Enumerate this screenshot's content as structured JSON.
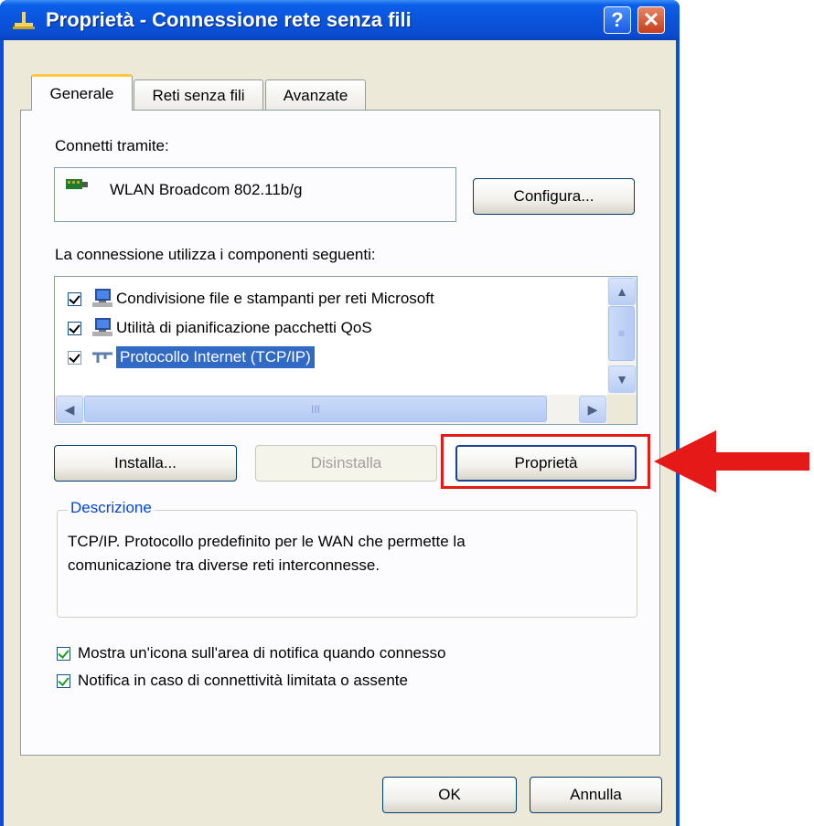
{
  "window": {
    "title": "Proprietà - Connessione rete senza fili",
    "help_glyph": "?",
    "close_glyph": "✕"
  },
  "tabs": [
    {
      "label": "Generale",
      "active": true
    },
    {
      "label": "Reti senza fili",
      "active": false
    },
    {
      "label": "Avanzate",
      "active": false
    }
  ],
  "general": {
    "connect_via_label": "Connetti tramite:",
    "device_name": "WLAN Broadcom 802.11b/g",
    "configure_button": "Configura...",
    "components_label": "La connessione utilizza i componenti seguenti:",
    "components": [
      {
        "label": "Condivisione file e stampanti per reti Microsoft",
        "checked": true,
        "selected": false,
        "icon": "network-computer-icon"
      },
      {
        "label": "Utilità di pianificazione pacchetti QoS",
        "checked": true,
        "selected": false,
        "icon": "network-computer-icon"
      },
      {
        "label": "Protocollo Internet (TCP/IP)",
        "checked": true,
        "selected": true,
        "icon": "protocol-icon"
      }
    ],
    "scroll_thumb_glyph": "III",
    "install_button": "Installa...",
    "uninstall_button": "Disinstalla",
    "properties_button": "Proprietà",
    "description_title": "Descrizione",
    "description_text_line1": "TCP/IP. Protocollo predefinito per le WAN che permette la",
    "description_text_line2": "comunicazione tra diverse reti interconnesse.",
    "show_icon_option": {
      "label": "Mostra un'icona sull'area di notifica quando connesso",
      "checked": true
    },
    "notify_option": {
      "label": "Notifica in caso di connettività limitata o assente",
      "checked": true
    }
  },
  "footer": {
    "ok_button": "OK",
    "cancel_button": "Annulla"
  },
  "annotation": {
    "highlight_color": "#e61919",
    "arrow_color": "#e61919"
  },
  "colors": {
    "title_bar": "#0a54dc",
    "dialog_bg": "#ece9d8",
    "selection": "#316ac5",
    "tab_highlight": "#ffc83c"
  }
}
